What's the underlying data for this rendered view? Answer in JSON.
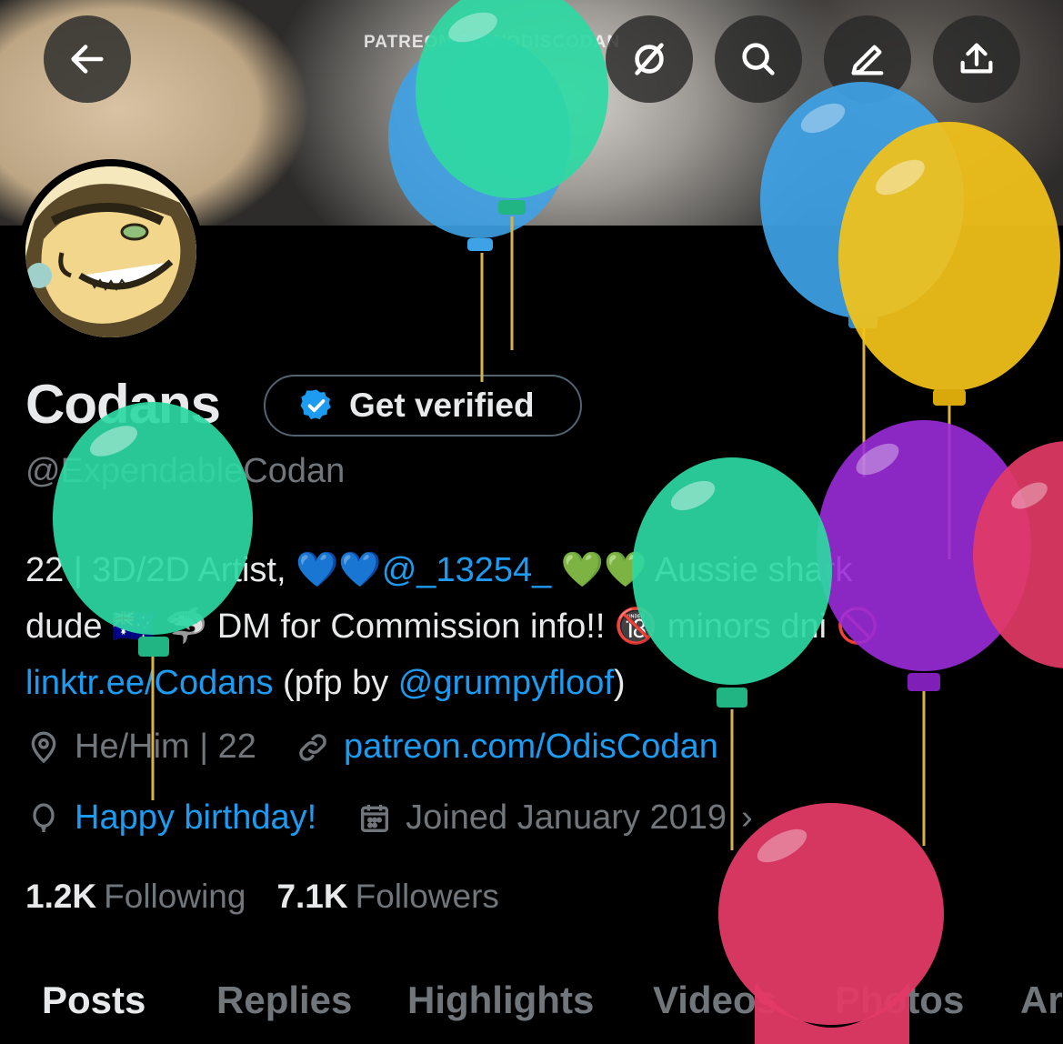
{
  "banner": {
    "text": "PATREON.COM/ODISCODAN"
  },
  "top_buttons": [
    "back-arrow-icon",
    "grok-icon",
    "search-icon",
    "edit-icon",
    "share-icon"
  ],
  "profile": {
    "name": "Codans",
    "verify_label": "Get verified",
    "handle": "@ExpendableCodan"
  },
  "bio": {
    "line1_pre": "22 | 3D/2D Artist, 💙💙",
    "line1_link": "@_13254_",
    "line1_post": " 💚💚 Aussie shark",
    "line2": "dude 🇦🇺 🦈 DM for Commission info!! 🔞 minors dni 🚫",
    "line3_link": "linktr.ee/Codans",
    "line3_mid": " (pfp by ",
    "line3_link2": "@grumpyfloof",
    "line3_end": ")"
  },
  "meta": {
    "location": "He/Him | 22",
    "website": "patreon.com/OdisCodan",
    "birthday": "Happy birthday!",
    "joined": "Joined January 2019",
    "chevron": "›"
  },
  "stats": {
    "following_count": "1.2K",
    "following_label": "Following",
    "followers_count": "7.1K",
    "followers_label": "Followers"
  },
  "tabs": [
    "Posts",
    "Replies",
    "Highlights",
    "Videos",
    "Photos",
    "Ar"
  ],
  "colors": {
    "background": "#000000",
    "text": "#e7e9ea",
    "muted": "#71767b",
    "link": "#1d9bf0",
    "balloon_green": "#2ed8a3",
    "balloon_blue": "#3ea2e6",
    "balloon_yellow": "#f2c21a",
    "balloon_purple": "#9a2bd8",
    "balloon_red": "#e23a66"
  }
}
